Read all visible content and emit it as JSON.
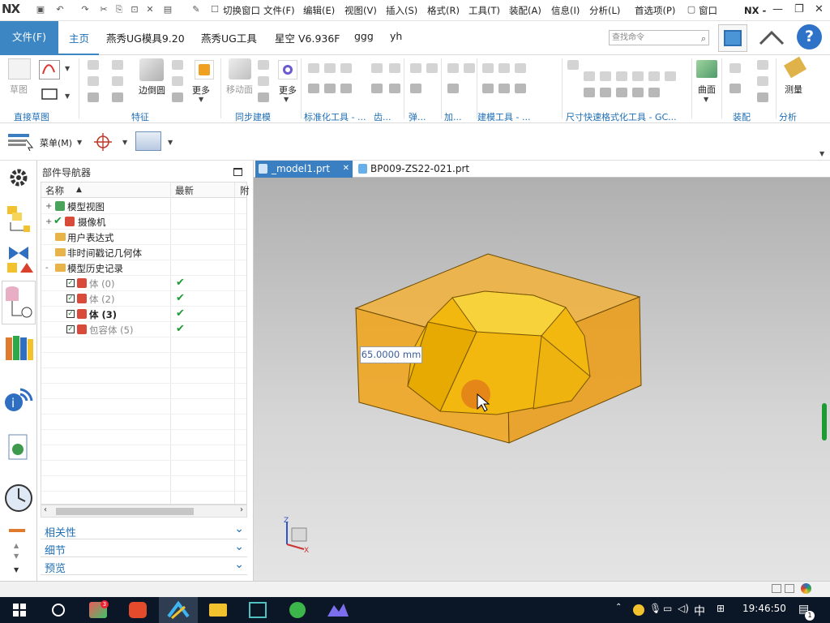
{
  "app": {
    "logo": "NX",
    "title_short": "NX -"
  },
  "quick_access": {
    "menus": [
      "切换窗口",
      "文件(F)",
      "编辑(E)",
      "视图(V)",
      "插入(S)",
      "格式(R)",
      "工具(T)",
      "装配(A)",
      "信息(I)",
      "分析(L)",
      "首选项(P)",
      "窗口"
    ]
  },
  "ribbon_tabs": [
    "文件(F)",
    "主页",
    "燕秀UG模具9.20",
    "燕秀UG工具",
    "星空 V6.936F",
    "ggg",
    "yh"
  ],
  "search": {
    "placeholder": "查找命令"
  },
  "ribbon": {
    "buttons": {
      "sketch": "草图",
      "edge_blend": "边倒圆",
      "more1": "更多",
      "move_face": "移动面",
      "more2": "更多",
      "surface": "曲面",
      "measure": "测量"
    },
    "groups": [
      "直接草图",
      "特征",
      "同步建模",
      "标准化工具 - ...",
      "齿...",
      "弹...",
      "加...",
      "建模工具 - ...",
      "尺寸快速格式化工具 - GC...",
      "装配",
      "分析"
    ]
  },
  "toolbar2": {
    "menu_label": "菜单(M)"
  },
  "navigator": {
    "title": "部件导航器",
    "columns": [
      "名称",
      "最新",
      "附"
    ],
    "rows": [
      {
        "label": "模型视图",
        "latest": ""
      },
      {
        "label": "摄像机",
        "latest": ""
      },
      {
        "label": "用户表达式",
        "latest": ""
      },
      {
        "label": "非时间戳记几何体",
        "latest": ""
      },
      {
        "label": "模型历史记录",
        "latest": ""
      },
      {
        "label": "体 (0)",
        "latest": "✔"
      },
      {
        "label": "体 (2)",
        "latest": "✔"
      },
      {
        "label": "体 (3)",
        "latest": "✔"
      },
      {
        "label": "包容体 (5)",
        "latest": "✔"
      }
    ],
    "panels": [
      "相关性",
      "细节",
      "预览"
    ]
  },
  "doc_tabs": [
    "_model1.prt",
    "BP009-ZS22-021.prt"
  ],
  "viewport": {
    "dimension_label": "65.0000 mm"
  },
  "axis": {
    "z": "Z",
    "x": "X"
  },
  "taskbar": {
    "time": "19:46:50",
    "ime": "中",
    "notify_count": "1",
    "badge": "3"
  },
  "colors": {
    "accent": "#3c86c4",
    "box_orange": "#f0a51e",
    "solid_yellow": "#f2b80f"
  }
}
